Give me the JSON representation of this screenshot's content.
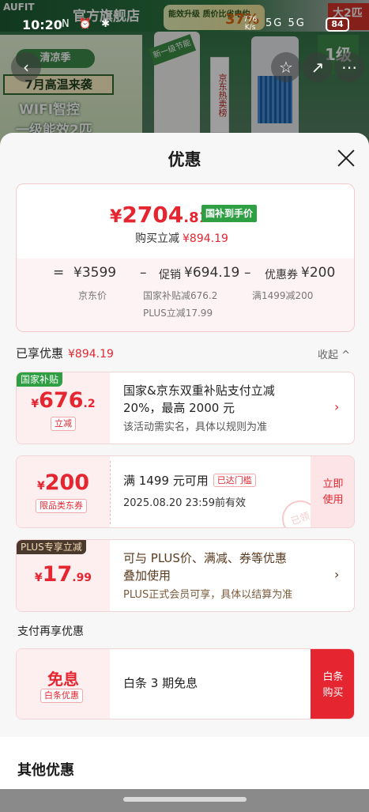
{
  "status_bar": {
    "time": "10:20",
    "left_icons": "N ⏰ ✱",
    "net_speed": "776",
    "net_unit": "K/s",
    "signal": "5G 5G",
    "battery": "84"
  },
  "background": {
    "brand": "AUFIT",
    "store": "官方旗舰店",
    "energy_label": "能效升级 质价比省电约",
    "energy_pct": "37%",
    "big_tag": "大2匹",
    "summer": "清凉季",
    "heat": "7月高温来袭",
    "wifi": "WIFI智控",
    "eff": "一级能效2匹",
    "new_level": "新一级节能",
    "hot": "京东热卖榜",
    "level": "1级"
  },
  "sheet": {
    "title": "优惠",
    "summary": {
      "currency": "¥",
      "price_int": "2704",
      "price_dec": ".81",
      "subsidy_tag": "国补到手价",
      "buy_reduce_label": "购买立减",
      "buy_reduce_amount": "¥894.19",
      "eq": "=",
      "jd_price": "¥3599",
      "minus1": "–",
      "promo_label": "促销",
      "promo_amount": "¥694.19",
      "minus2": "–",
      "coupon_label": "优惠券",
      "coupon_amount": "¥200",
      "jd_price_label": "京东价",
      "subsidy_detail": "国家补贴减676.2",
      "plus_detail": "PLUS立减17.99",
      "coupon_detail": "满1499减200"
    },
    "enjoyed_label": "已享优惠",
    "enjoyed_amount": "¥894.19",
    "collapse_label": "收起 ^",
    "card1": {
      "tag": "国家补贴",
      "currency": "¥",
      "int": "676",
      "dec": ".2",
      "box": "立减",
      "desc_line1": "国家&京东双重补贴支付立减",
      "desc_line2": "20%，最高 2000 元",
      "sub": "该活动需实名，具体以规则为准",
      "chev": "›"
    },
    "card2": {
      "currency": "¥",
      "int": "200",
      "box": "限品类东券",
      "desc_line1": "满 1499 元可用",
      "used_tag": "已达门槛",
      "desc_line2": "2025.08.20 23:59前有效",
      "action": "立即使用",
      "stamp": "已领"
    },
    "card3": {
      "tag": "PLUS专享立减",
      "currency": "¥",
      "int": "17",
      "dec": ".99",
      "desc_line1": "可与 PLUS价、满减、券等优惠",
      "desc_line2": "叠加使用",
      "sub": "PLUS正式会员可享，具体以结算为准",
      "chev": "›"
    },
    "pay_title": "支付再享优惠",
    "card4": {
      "left_text": "免息",
      "box": "白条优惠",
      "desc": "白条 3 期免息",
      "action": "白条购买"
    },
    "other_title": "其他优惠"
  },
  "colors": {
    "accent_red": "#e52630",
    "subsidy_green": "#2ea043",
    "plus_dark": "#4a3a2e"
  }
}
